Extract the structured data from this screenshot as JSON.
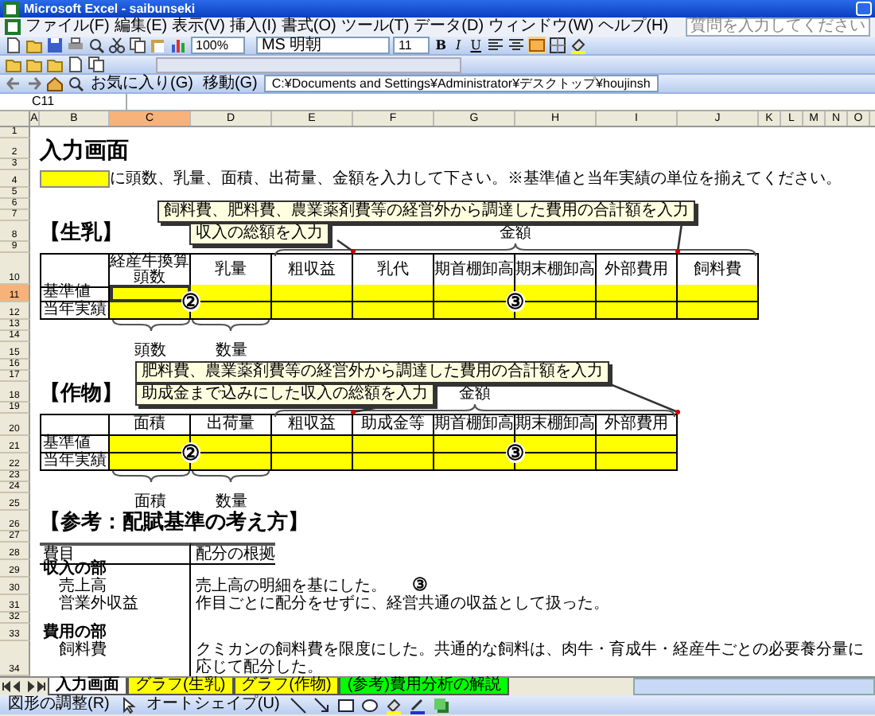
{
  "window": {
    "title": "Microsoft Excel - saibunseki"
  },
  "menu": [
    "ファイル(F)",
    "編集(E)",
    "表示(V)",
    "挿入(I)",
    "書式(O)",
    "ツール(T)",
    "データ(D)",
    "ウィンドウ(W)",
    "ヘルプ(H)"
  ],
  "help_box": {
    "placeholder": "質問を入力してください"
  },
  "toolbar": {
    "zoom": "100%",
    "font": "MS 明朝",
    "size": "11",
    "format_buttons": [
      "B",
      "I",
      "U"
    ]
  },
  "web_toolbar": {
    "favorites": "お気に入り(G)",
    "go": "移動(G)",
    "address": "C:¥Documents and Settings¥Administrator¥デスクトップ¥houjinsh"
  },
  "name_box": "C11",
  "columns": [
    {
      "label": "A",
      "selected": false
    },
    {
      "label": "B",
      "selected": false
    },
    {
      "label": "C",
      "selected": true
    },
    {
      "label": "D",
      "selected": false
    },
    {
      "label": "E",
      "selected": false
    },
    {
      "label": "F",
      "selected": false
    },
    {
      "label": "G",
      "selected": false
    },
    {
      "label": "H",
      "selected": false
    },
    {
      "label": "I",
      "selected": false
    },
    {
      "label": "J",
      "selected": false
    },
    {
      "label": "K",
      "selected": false
    },
    {
      "label": "L",
      "selected": false
    },
    {
      "label": "M",
      "selected": false
    },
    {
      "label": "N",
      "selected": false
    },
    {
      "label": "O",
      "selected": false
    }
  ],
  "rows": [
    {
      "label": "1",
      "selected": false
    },
    {
      "label": "2",
      "selected": false
    },
    {
      "label": "3",
      "selected": false
    },
    {
      "label": "4",
      "selected": false
    },
    {
      "label": "5",
      "selected": false
    },
    {
      "label": "6",
      "selected": false
    },
    {
      "label": "7",
      "selected": false
    },
    {
      "label": "8",
      "selected": false
    },
    {
      "label": "9",
      "selected": false
    },
    {
      "label": "10",
      "selected": false
    },
    {
      "label": "11",
      "selected": true
    },
    {
      "label": "12",
      "selected": false
    },
    {
      "label": "13",
      "selected": false
    },
    {
      "label": "14",
      "selected": false
    },
    {
      "label": "15",
      "selected": false
    },
    {
      "label": "16",
      "selected": false
    },
    {
      "label": "17",
      "selected": false
    },
    {
      "label": "18",
      "selected": false
    },
    {
      "label": "19",
      "selected": false
    },
    {
      "label": "20",
      "selected": false
    },
    {
      "label": "21",
      "selected": false
    },
    {
      "label": "22",
      "selected": false
    },
    {
      "label": "23",
      "selected": false
    },
    {
      "label": "24",
      "selected": false
    },
    {
      "label": "25",
      "selected": false
    },
    {
      "label": "26",
      "selected": false
    },
    {
      "label": "27",
      "selected": false
    },
    {
      "label": "28",
      "selected": false
    },
    {
      "label": "29",
      "selected": false
    },
    {
      "label": "30",
      "selected": false
    },
    {
      "label": "31",
      "selected": false
    },
    {
      "label": "32",
      "selected": false
    },
    {
      "label": "33",
      "selected": false
    },
    {
      "label": "34",
      "selected": false
    }
  ],
  "sheet": {
    "title": "入力画面",
    "instruction": "に頭数、乳量、面積、出荷量、金額を入力して下さい。※基準値と当年実績の単位を揃えてください。",
    "dairy": {
      "heading": "【生乳】",
      "callout_cost": "飼料費、肥料費、農業薬剤費等の経営外から調達した費用の合計額を入力",
      "callout_income": "収入の総額を入力",
      "brace_label": "金額",
      "columns": [
        "経産牛換算頭数",
        "乳量",
        "粗収益",
        "乳代",
        "期首棚卸高",
        "期末棚卸高",
        "外部費用",
        "飼料費"
      ],
      "row_labels": [
        "基準値",
        "当年実績"
      ],
      "marks": [
        "②",
        "③"
      ],
      "below_labels": [
        "頭数",
        "数量"
      ]
    },
    "crop": {
      "heading": "【作物】",
      "callout_cost": "肥料費、農業薬剤費等の経営外から調達した費用の合計額を入力",
      "callout_income": "助成金まで込みにした収入の総額を入力",
      "brace_label": "金額",
      "columns": [
        "面積",
        "出荷量",
        "粗収益",
        "助成金等",
        "期首棚卸高",
        "期末棚卸高",
        "外部費用"
      ],
      "row_labels": [
        "基準値",
        "当年実績"
      ],
      "marks": [
        "②",
        "③"
      ],
      "below_labels": [
        "面積",
        "数量"
      ]
    },
    "reference": {
      "heading": "【参考：配賦基準の考え方】",
      "header": [
        "費目",
        "配分の根拠"
      ],
      "mark": "③",
      "rows": [
        {
          "kind": "section",
          "item": "収入の部"
        },
        {
          "kind": "item",
          "item": "売上高",
          "basis": "売上高の明細を基にした。"
        },
        {
          "kind": "item",
          "item": "営業外収益",
          "basis": "作目ごとに配分をせずに、経営共通の収益として扱った。"
        },
        {
          "kind": "section",
          "item": "費用の部"
        },
        {
          "kind": "item",
          "item": "飼料費",
          "basis": "クミカンの飼料費を限度にした。共通的な飼料は、肉牛・育成牛・経産牛ごとの必要養分量に応じて配分した。"
        }
      ]
    }
  },
  "sheet_tabs": [
    {
      "label": "入力画面",
      "selected": true,
      "color": "#ffffff"
    },
    {
      "label": "グラフ(生乳)",
      "selected": false,
      "color": "#ffff00"
    },
    {
      "label": "グラフ(作物)",
      "selected": false,
      "color": "#ffff00"
    },
    {
      "label": "(参考)費用分析の解説",
      "selected": false,
      "color": "#00ff00"
    }
  ],
  "drawing_toolbar": {
    "draw": "図形の調整(R)",
    "autoshapes": "オートシェイプ(U)"
  }
}
